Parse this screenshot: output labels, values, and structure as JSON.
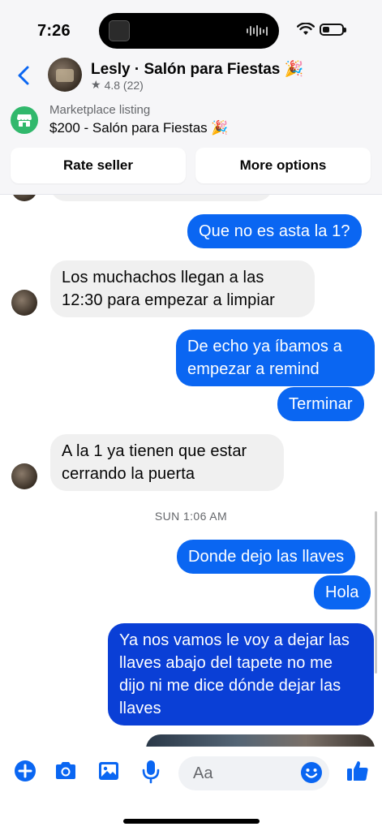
{
  "status_bar": {
    "time": "7:26"
  },
  "header": {
    "name": "Lesly · Salón para Fiestas 🎉",
    "rating": "4.8 (22)"
  },
  "marketplace": {
    "label": "Marketplace listing",
    "title": "$200 - Salón para Fiestas 🎉",
    "rate_button": "Rate seller",
    "more_button": "More options"
  },
  "messages": [
    {
      "side": "out",
      "text": "Que no es asta la 1?"
    },
    {
      "side": "in",
      "text": "Los muchachos llegan a las 12:30 para empezar a limpiar"
    },
    {
      "side": "out",
      "text": "De echo ya íbamos a empezar a remind"
    },
    {
      "side": "out",
      "text": "Terminar"
    },
    {
      "side": "in",
      "text": "A la 1 ya tienen que estar cerrando la puerta"
    },
    {
      "side": "out",
      "text": "Donde dejo las llaves"
    },
    {
      "side": "out",
      "text": "Hola"
    },
    {
      "side": "out",
      "text": "Ya nos vamos le voy a dejar las llaves abajo del tapete no me dijo ni me dice dónde dejar las llaves"
    }
  ],
  "timestamp": "SUN 1:06 AM",
  "composer": {
    "placeholder": "Aa"
  },
  "colors": {
    "accent": "#0a66f2",
    "incoming": "#f0f0f0",
    "marketplace_green": "#31b86c"
  },
  "icons": [
    "back-icon",
    "star-icon",
    "marketplace-icon",
    "plus-icon",
    "camera-icon",
    "image-icon",
    "microphone-icon",
    "emoji-icon",
    "thumbs-up-icon"
  ]
}
